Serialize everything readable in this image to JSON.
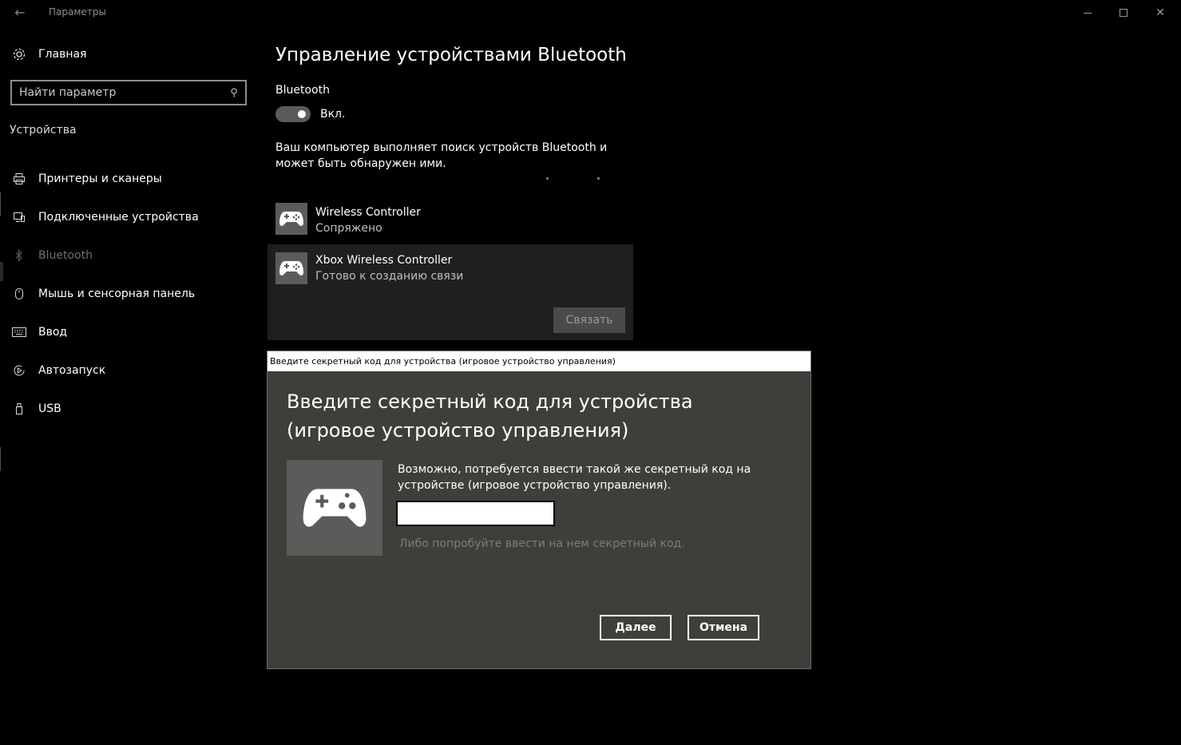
{
  "window": {
    "title": "Параметры",
    "back_icon": "back-arrow-icon",
    "controls": [
      "minimize",
      "maximize",
      "close"
    ]
  },
  "sidebar": {
    "home_label": "Главная",
    "search_placeholder": "Найти параметр",
    "section_title": "Устройства",
    "items": [
      {
        "label": "Принтеры и сканеры",
        "icon": "printer-icon",
        "active": false
      },
      {
        "label": "Подключенные устройства",
        "icon": "devices-icon",
        "active": false
      },
      {
        "label": "Bluetooth",
        "icon": "bluetooth-icon",
        "active": true
      },
      {
        "label": "Мышь и сенсорная панель",
        "icon": "mouse-icon",
        "active": false
      },
      {
        "label": "Ввод",
        "icon": "keyboard-icon",
        "active": false
      },
      {
        "label": "Автозапуск",
        "icon": "autoplay-icon",
        "active": false
      },
      {
        "label": "USB",
        "icon": "usb-icon",
        "active": false
      }
    ]
  },
  "main": {
    "title": "Управление устройствами Bluetooth",
    "bluetooth_label": "Bluetooth",
    "toggle_state": "Вкл.",
    "scan_text": "Ваш компьютер выполняет поиск устройств Bluetooth и может быть обнаружен ими.",
    "devices": [
      {
        "name": "Wireless Controller",
        "status": "Сопряжено",
        "icon": "gamepad-icon"
      },
      {
        "name": "Xbox Wireless Controller",
        "status": "Готово к созданию связи",
        "icon": "gamepad-icon",
        "action": "Связать"
      }
    ]
  },
  "dialog": {
    "titlebar": "Введите секретный код для устройства (игровое устройство управления)",
    "heading": "Введите секретный код для устройства (игровое устройство управления)",
    "description": "Возможно, потребуется ввести такой же секретный код на устройстве (игровое устройство управления).",
    "pin_value": "",
    "hint": "Либо попробуйте ввести на нем секретный код.",
    "next_label": "Далее",
    "cancel_label": "Отмена"
  },
  "colors": {
    "background": "#000000",
    "dialog_bg": "#3f3e3b",
    "tile_bg": "#5c5b59",
    "selected_device_bg": "#1f1f1f"
  }
}
